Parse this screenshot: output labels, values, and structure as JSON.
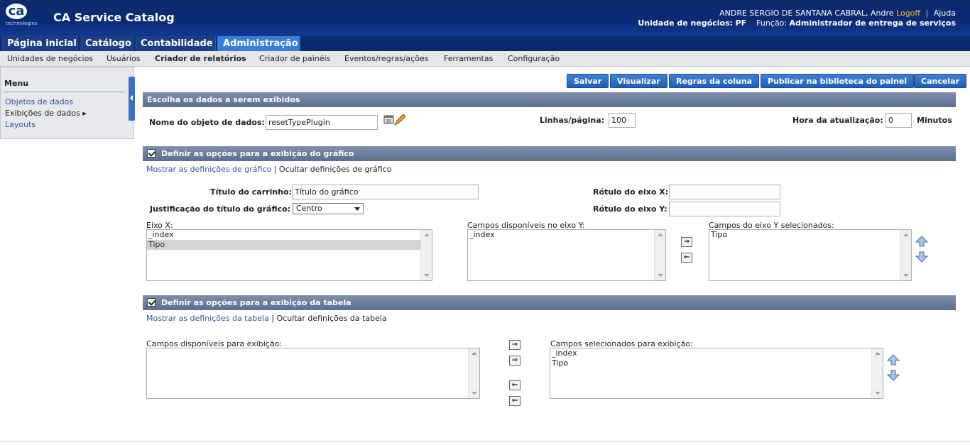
{
  "header": {
    "logo_text": "ca",
    "logo_sub": "technologies",
    "app_title": "CA Service Catalog",
    "user_name": "ANDRE SERGIO DE SANTANA CABRAL, Andre",
    "logoff": "Logoff",
    "help": "Ajuda",
    "bu_label": "Unidade de negócios:",
    "bu_value": "PF",
    "role_label": "Função:",
    "role_value": "Administrador de entrega de serviços"
  },
  "tabs": [
    {
      "label": "Página inicial"
    },
    {
      "label": "Catálogo"
    },
    {
      "label": "Contabilidade"
    },
    {
      "label": "Administração"
    }
  ],
  "subtabs": [
    {
      "label": "Unidades de negócios"
    },
    {
      "label": "Usuários"
    },
    {
      "label": "Criador de relatórios"
    },
    {
      "label": "Criador de painéis"
    },
    {
      "label": "Eventos/regras/ações"
    },
    {
      "label": "Ferramentas"
    },
    {
      "label": "Configuração"
    }
  ],
  "menu": {
    "title": "Menu",
    "items": [
      {
        "label": "Objetos de dados"
      },
      {
        "label": "Exibições de dados ▸"
      },
      {
        "label": "Layouts"
      }
    ]
  },
  "toolbar": {
    "save": "Salvar",
    "view": "Visualizar",
    "column_rules": "Regras da coluna",
    "publish": "Publicar na biblioteca do painel",
    "cancel": "Cancelar"
  },
  "data_section": {
    "title": "Escolha os dados a serem exibidos",
    "object_label": "Nome do objeto de dados:",
    "object_value": "resetTypePlugin",
    "rows_label": "Linhas/página:",
    "rows_value": "100",
    "refresh_label": "Hora da atualização:",
    "refresh_value": "0",
    "refresh_unit": "Minutos"
  },
  "chart_section": {
    "title": "Definir as opções para a exibição do gráfico",
    "show_link": "Mostrar as definições de gráfico",
    "sep": "|",
    "hide_text": "Ocultar definições de gráfico",
    "title_label": "Título do carrinho:",
    "title_value": "Título do gráfico",
    "just_label": "Justificação do título do gráfico:",
    "just_value": "Centro",
    "xaxis_label": "Rótulo do eixo X:",
    "xaxis_value": "",
    "yaxis_label": "Rótulo do eixo Y:",
    "yaxis_value": "",
    "eixo_x_label": "Eixo X:",
    "eixo_x_items": [
      "_index",
      "Tipo"
    ],
    "y_avail_label": "Campos disponíveis no eixo Y:",
    "y_avail_items": [
      "_index"
    ],
    "y_sel_label": "Campos do eixo Y selecionados:",
    "y_sel_items": [
      "Tipo"
    ],
    "move_right": "→",
    "move_left": "←"
  },
  "table_section": {
    "title": "Definir as opções para a exibição da tabela",
    "show_link": "Mostrar as definições da tabela",
    "sep": "|",
    "hide_text": "Ocultar definições da tabela",
    "avail_label": "Campos disponíveis para exibição:",
    "avail_items": [],
    "sel_label": "Campos selecionados para exibição:",
    "sel_items": [
      "_index",
      "Tipo"
    ],
    "move_right": "→",
    "move_all_right": "⇒",
    "move_left": "←",
    "move_all_left": "⇐"
  }
}
